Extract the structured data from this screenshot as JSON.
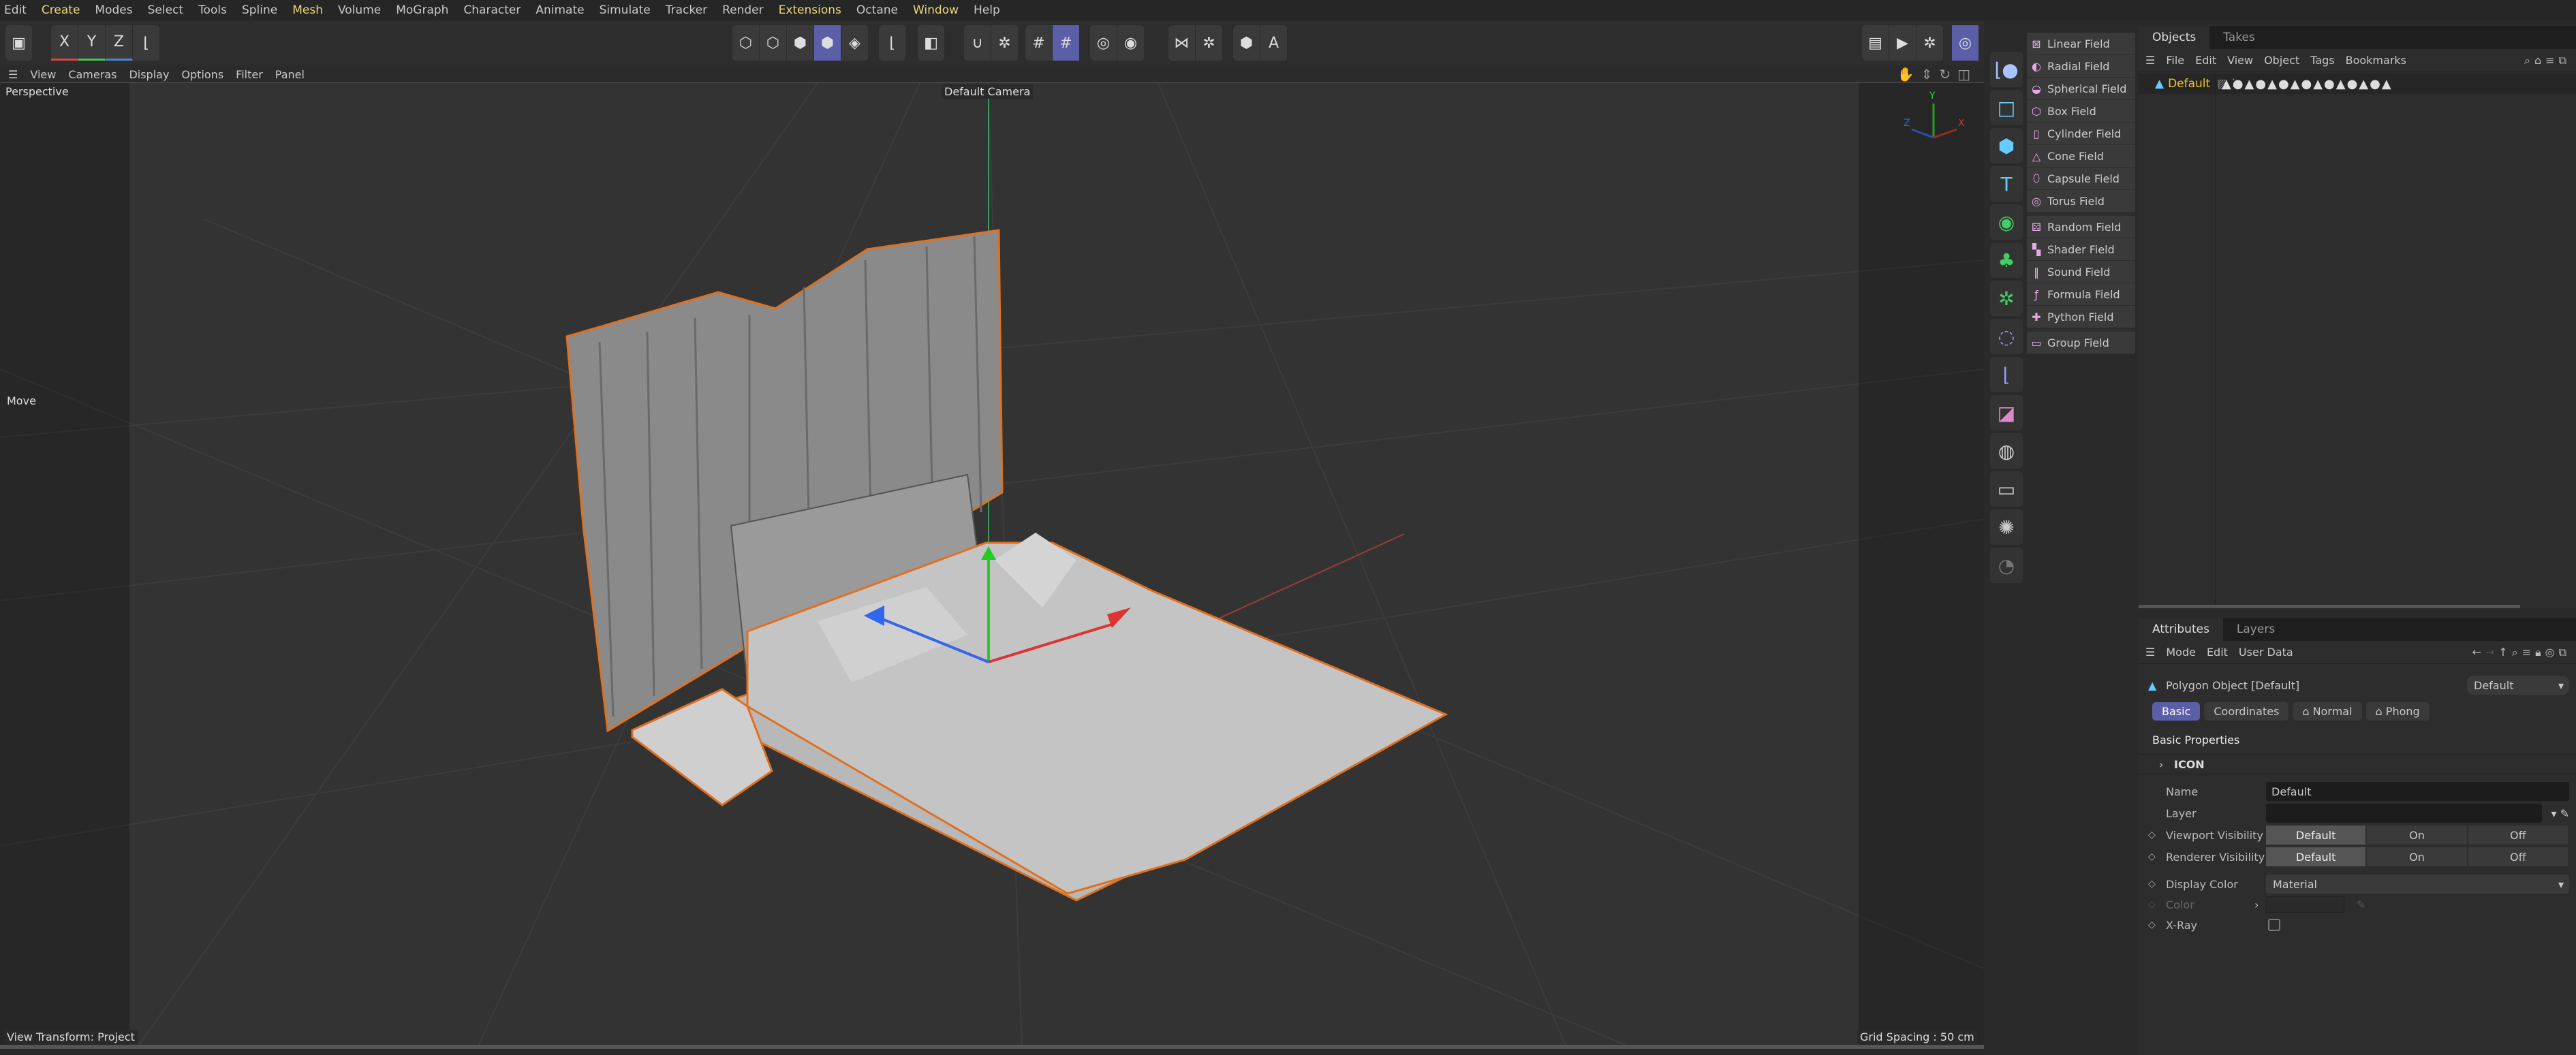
{
  "menubar": [
    "Edit",
    "Create",
    "Modes",
    "Select",
    "Tools",
    "Spline",
    "Mesh",
    "Volume",
    "MoGraph",
    "Character",
    "Animate",
    "Simulate",
    "Tracker",
    "Render",
    "Extensions",
    "Octane",
    "Window",
    "Help"
  ],
  "toolbar": {
    "axis_x": "X",
    "axis_y": "Y",
    "axis_z": "Z"
  },
  "viewport": {
    "menu": [
      "View",
      "Cameras",
      "Display",
      "Options",
      "Filter",
      "Panel"
    ],
    "view_name": "Perspective",
    "camera": "Default Camera",
    "tool": "Move",
    "view_transform": "View Transform: Project",
    "grid_spacing": "Grid Spacing : 50 cm",
    "axis_labels": [
      "X",
      "Y",
      "Z"
    ],
    "selection_color": "#e07020"
  },
  "fields": [
    "Linear Field",
    "Radial Field",
    "Spherical Field",
    "Box Field",
    "Cylinder Field",
    "Cone Field",
    "Capsule Field",
    "Torus Field",
    "Random Field",
    "Shader Field",
    "Sound Field",
    "Formula Field",
    "Python Field",
    "Group Field"
  ],
  "objects": {
    "tabs": [
      "Objects",
      "Takes"
    ],
    "menu": [
      "File",
      "Edit",
      "View",
      "Object",
      "Tags",
      "Bookmarks"
    ],
    "item": "Default",
    "item_color": "#f0c030"
  },
  "attributes": {
    "tabs": [
      "Attributes",
      "Layers"
    ],
    "menu": [
      "Mode",
      "Edit",
      "User Data"
    ],
    "object_title": "Polygon Object [Default]",
    "preset": "Default",
    "subtabs": [
      "Basic",
      "Coordinates",
      "Normal",
      "Phong"
    ],
    "section": "Basic Properties",
    "group": "ICON",
    "name_label": "Name",
    "name_value": "Default",
    "layer_label": "Layer",
    "viewport_visibility": {
      "label": "Viewport Visibility",
      "options": [
        "Default",
        "On",
        "Off"
      ]
    },
    "renderer_visibility": {
      "label": "Renderer Visibility",
      "options": [
        "Default",
        "On",
        "Off"
      ]
    },
    "display_color_label": "Display Color",
    "display_color_value": "Material",
    "color_label": "Color",
    "xray_label": "X-Ray"
  },
  "accent": "#5a5fa8"
}
